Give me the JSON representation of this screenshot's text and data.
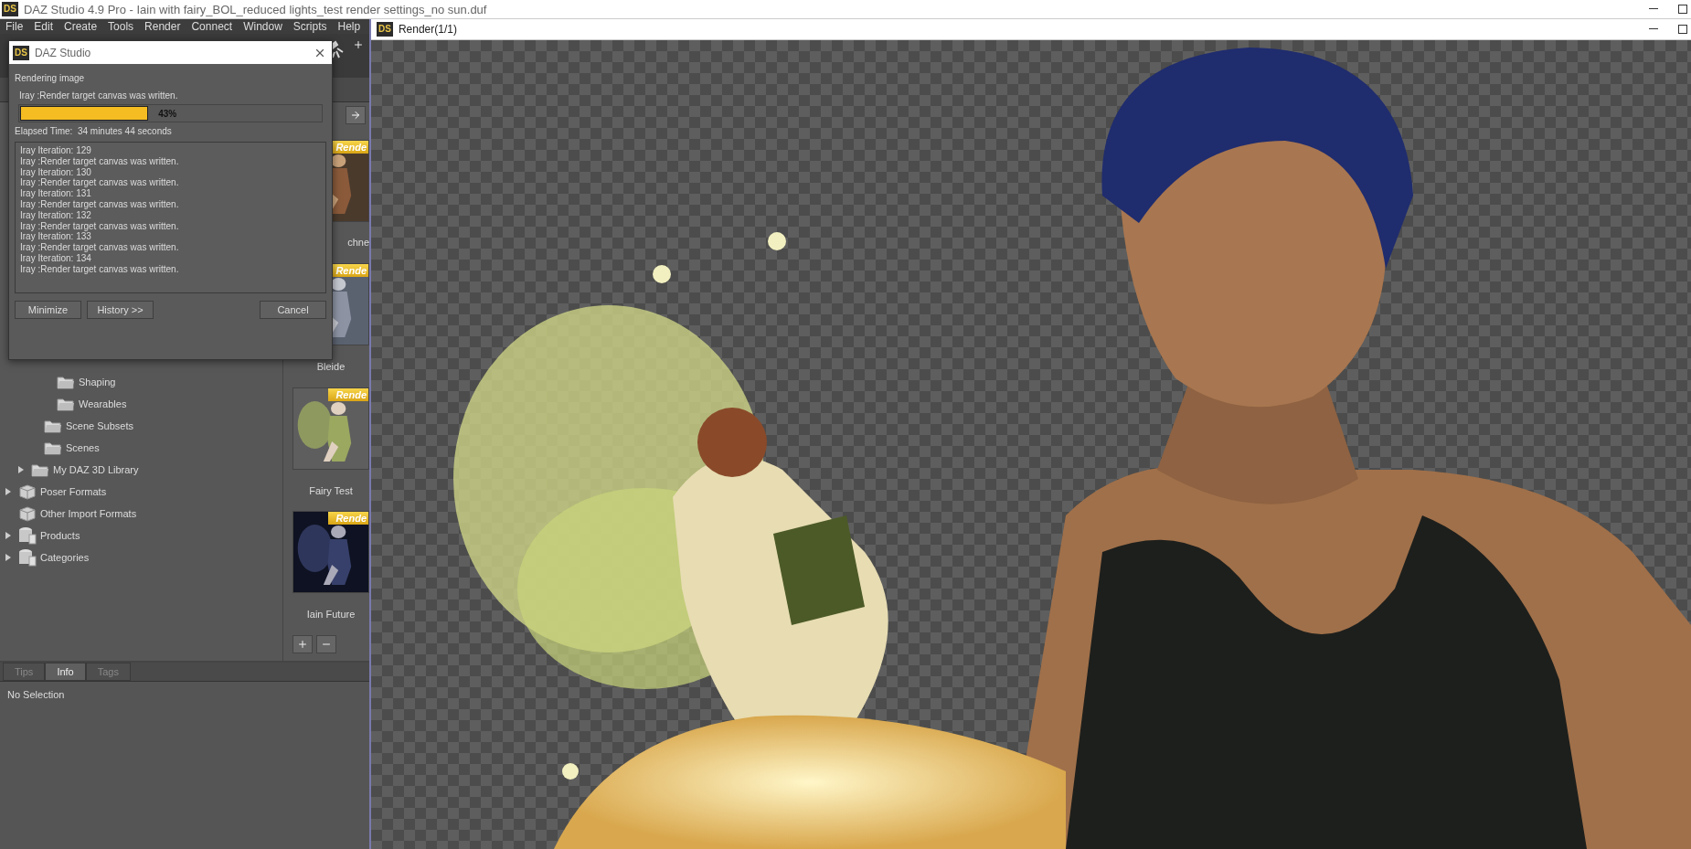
{
  "main_window": {
    "logo": "DS",
    "title": "DAZ Studio 4.9 Pro - Iain with fairy_BOL_reduced lights_test render settings_no sun.duf"
  },
  "menu": [
    "File",
    "Edit",
    "Create",
    "Tools",
    "Render",
    "Connect",
    "Window",
    "Scripts",
    "Help"
  ],
  "dialog": {
    "logo": "DS",
    "title": "DAZ Studio",
    "heading": "Rendering image",
    "status": "Iray :Render target canvas was written.",
    "progress": {
      "level": 0.43,
      "label": "43%"
    },
    "elapsed": "Elapsed Time:  34 minutes 44 seconds",
    "log": [
      "Iray Iteration: 129",
      "Iray :Render target canvas was written.",
      "Iray Iteration: 130",
      "Iray :Render target canvas was written.",
      "Iray Iteration: 131",
      "Iray :Render target canvas was written.",
      "Iray Iteration: 132",
      "Iray :Render target canvas was written.",
      "Iray Iteration: 133",
      "Iray :Render target canvas was written.",
      "Iray Iteration: 134",
      "Iray :Render target canvas was written."
    ],
    "buttons": [
      "Minimize",
      "History >>",
      "Cancel"
    ]
  },
  "tree": [
    {
      "children": [
        {
          "children": [
            {
              "children": [
                {
                  "label": "Shaping",
                  "kind": "folder",
                  "expandable": false
                },
                {
                  "label": "Wearables",
                  "kind": "folder",
                  "expandable": false
                }
              ]
            },
            {
              "label": "Scene Subsets",
              "kind": "folder",
              "expandable": false
            },
            {
              "label": "Scenes",
              "kind": "folder",
              "expandable": false
            }
          ]
        },
        {
          "label": "My DAZ 3D Library",
          "kind": "folder",
          "expandable": true
        }
      ]
    },
    {
      "label": "Poser Formats",
      "kind": "package",
      "expandable": true
    },
    {
      "label": "Other Import Formats",
      "kind": "package",
      "expandable": false
    },
    {
      "label": "Products",
      "kind": "database",
      "expandable": true
    },
    {
      "label": "Categories",
      "kind": "database",
      "expandable": true
    }
  ],
  "thumbnails": [
    {
      "banner": "Rende",
      "label": "chne",
      "cut_left": true,
      "kind": "picture"
    },
    {
      "banner": "Rende",
      "label": "Bleide",
      "cut_left": false,
      "kind": "picture"
    },
    {
      "banner": "Rende",
      "label": "Fairy Test",
      "cut_left": false,
      "kind": "picture"
    },
    {
      "banner": "Rende",
      "label": "Iain Future",
      "cut_left": false,
      "kind": "picture"
    }
  ],
  "bottom_tabs": [
    {
      "label": "Tips",
      "selected": false
    },
    {
      "label": "Info",
      "selected": true
    },
    {
      "label": "Tags",
      "selected": false
    }
  ],
  "info_text": "No Selection",
  "render_window": {
    "logo": "DS",
    "title": "Render(1/1)",
    "kind": "picture"
  }
}
